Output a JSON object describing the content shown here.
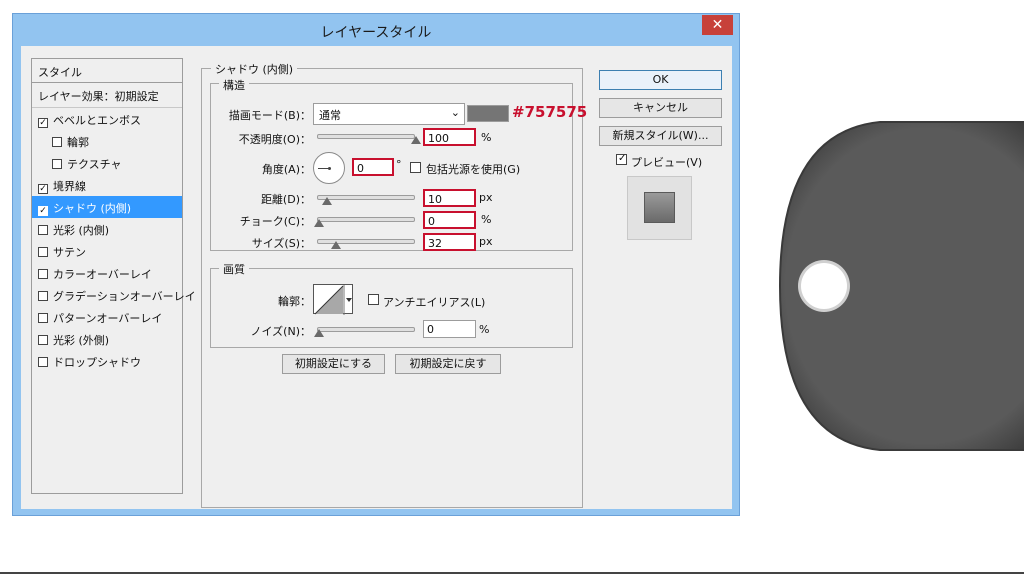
{
  "dialog": {
    "title": "レイヤースタイル",
    "close_label": "✕"
  },
  "style_list": {
    "header": "スタイル",
    "blend_options": "レイヤー効果：初期設定",
    "items": [
      {
        "label": "ベベルとエンボス",
        "checked": true,
        "sub": false,
        "selected": false
      },
      {
        "label": "輪郭",
        "checked": false,
        "sub": true,
        "selected": false
      },
      {
        "label": "テクスチャ",
        "checked": false,
        "sub": true,
        "selected": false
      },
      {
        "label": "境界線",
        "checked": true,
        "sub": false,
        "selected": false
      },
      {
        "label": "シャドウ (内側)",
        "checked": true,
        "sub": false,
        "selected": true
      },
      {
        "label": "光彩 (内側)",
        "checked": false,
        "sub": false,
        "selected": false
      },
      {
        "label": "サテン",
        "checked": false,
        "sub": false,
        "selected": false
      },
      {
        "label": "カラーオーバーレイ",
        "checked": false,
        "sub": false,
        "selected": false
      },
      {
        "label": "グラデーションオーバーレイ",
        "checked": false,
        "sub": false,
        "selected": false
      },
      {
        "label": "パターンオーバーレイ",
        "checked": false,
        "sub": false,
        "selected": false
      },
      {
        "label": "光彩 (外側)",
        "checked": false,
        "sub": false,
        "selected": false
      },
      {
        "label": "ドロップシャドウ",
        "checked": false,
        "sub": false,
        "selected": false
      }
    ]
  },
  "inner_shadow": {
    "section_title": "シャドウ (内側)",
    "structure_title": "構造",
    "blend_mode_label": "描画モード(B)：",
    "blend_mode_value": "通常",
    "color_hex": "#757575",
    "opacity_label": "不透明度(O)：",
    "opacity_value": "100",
    "opacity_unit": "%",
    "opacity_level": 1.0,
    "angle_label": "角度(A)：",
    "angle_value": "0",
    "angle_unit": "°",
    "global_light_label": "包括光源を使用(G)",
    "global_light_checked": false,
    "distance_label": "距離(D)：",
    "distance_value": "10",
    "distance_unit": "px",
    "choke_label": "チョーク(C)：",
    "choke_value": "0",
    "choke_unit": "%",
    "size_label": "サイズ(S)：",
    "size_value": "32",
    "size_unit": "px"
  },
  "quality": {
    "section_title": "画質",
    "contour_label": "輪郭：",
    "antialias_label": "アンチエイリアス(L)",
    "antialias_checked": false,
    "noise_label": "ノイズ(N)：",
    "noise_value": "0",
    "noise_unit": "%"
  },
  "buttons": {
    "make_default": "初期設定にする",
    "reset_default": "初期設定に戻す",
    "ok": "OK",
    "cancel": "キャンセル",
    "new_style": "新規スタイル(W)...",
    "preview_label": "プレビュー(V)",
    "preview_checked": true
  },
  "colors": {
    "shadow_color": "#757575",
    "tag_color": "#5a5a5a",
    "selected_row": "#3399ff",
    "title_bar": "#92c4f0",
    "close_button": "#c7413a"
  }
}
